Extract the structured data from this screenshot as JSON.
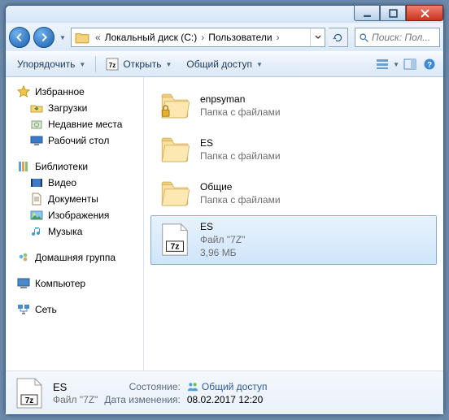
{
  "titlebar": {},
  "nav": {
    "path_items": [
      "Локальный диск (C:)",
      "Пользователи"
    ],
    "search_placeholder": "Поиск: Пол..."
  },
  "toolbar": {
    "organize": "Упорядочить",
    "open": "Открыть",
    "share": "Общий доступ"
  },
  "sidebar": {
    "favorites": {
      "title": "Избранное",
      "items": [
        "Загрузки",
        "Недавние места",
        "Рабочий стол"
      ]
    },
    "libraries": {
      "title": "Библиотеки",
      "items": [
        "Видео",
        "Документы",
        "Изображения",
        "Музыка"
      ]
    },
    "homegroup": {
      "title": "Домашняя группа"
    },
    "computer": {
      "title": "Компьютер"
    },
    "network": {
      "title": "Сеть"
    }
  },
  "files": [
    {
      "name": "enpsyman",
      "type": "Папка с файлами",
      "icon": "folder-lock"
    },
    {
      "name": "ES",
      "type": "Папка с файлами",
      "icon": "folder"
    },
    {
      "name": "Общие",
      "type": "Папка с файлами",
      "icon": "folder"
    },
    {
      "name": "ES",
      "type": "Файл \"7Z\"",
      "size": "3,96 МБ",
      "icon": "7z",
      "selected": true
    }
  ],
  "details": {
    "name": "ES",
    "type": "Файл \"7Z\"",
    "state_label": "Состояние:",
    "state_value": "Общий доступ",
    "modified_label": "Дата изменения:",
    "modified_value": "08.02.2017 12:20"
  }
}
